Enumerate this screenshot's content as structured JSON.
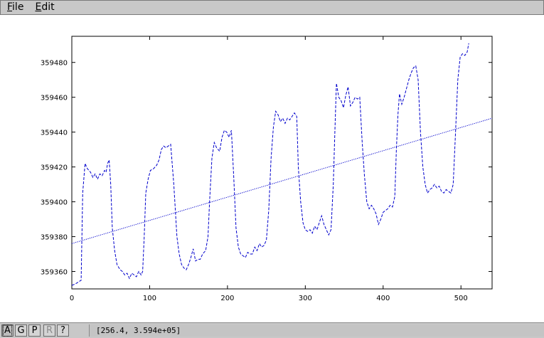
{
  "menubar": {
    "items": [
      {
        "label": "File",
        "mnemonic": "F",
        "rest": "ile"
      },
      {
        "label": "Edit",
        "mnemonic": "E",
        "rest": "dit"
      }
    ]
  },
  "toolbar": {
    "buttons": [
      {
        "label": "A",
        "state": "active"
      },
      {
        "label": "G",
        "state": "normal"
      },
      {
        "label": "P",
        "state": "normal"
      },
      {
        "label": "R",
        "state": "disabled"
      },
      {
        "label": "?",
        "state": "normal"
      }
    ]
  },
  "status": {
    "coords": "[256.4, 3.594e+05]"
  },
  "colors": {
    "series": "#0000cc",
    "background": "#ffffff",
    "chrome": "#c8c8c8"
  },
  "chart_data": {
    "type": "line",
    "title": "",
    "xlabel": "",
    "ylabel": "",
    "xlim": [
      0,
      540
    ],
    "ylim": [
      359350,
      359495
    ],
    "xticks": [
      0,
      100,
      200,
      300,
      400,
      500
    ],
    "yticks": [
      359360,
      359380,
      359400,
      359420,
      359440,
      359460,
      359480
    ],
    "grid": false,
    "legend": "none",
    "series": [
      {
        "style": "dashed",
        "points": [
          [
            0,
            359352
          ],
          [
            5,
            359353
          ],
          [
            12,
            359355
          ],
          [
            14,
            359405
          ],
          [
            17,
            359422
          ],
          [
            20,
            359419
          ],
          [
            24,
            359417
          ],
          [
            27,
            359414
          ],
          [
            30,
            359416
          ],
          [
            33,
            359413
          ],
          [
            36,
            359416
          ],
          [
            39,
            359415
          ],
          [
            42,
            359418
          ],
          [
            44,
            359417
          ],
          [
            46,
            359422
          ],
          [
            48,
            359424
          ],
          [
            50,
            359410
          ],
          [
            52,
            359385
          ],
          [
            55,
            359372
          ],
          [
            58,
            359364
          ],
          [
            62,
            359361
          ],
          [
            65,
            359360
          ],
          [
            68,
            359358
          ],
          [
            71,
            359359
          ],
          [
            74,
            359356
          ],
          [
            77,
            359359
          ],
          [
            80,
            359358
          ],
          [
            83,
            359357
          ],
          [
            86,
            359360
          ],
          [
            89,
            359358
          ],
          [
            91,
            359360
          ],
          [
            93,
            359380
          ],
          [
            95,
            359405
          ],
          [
            98,
            359413
          ],
          [
            101,
            359418
          ],
          [
            105,
            359419
          ],
          [
            109,
            359421
          ],
          [
            112,
            359424
          ],
          [
            115,
            359430
          ],
          [
            118,
            359432
          ],
          [
            121,
            359431
          ],
          [
            124,
            359432
          ],
          [
            127,
            359433
          ],
          [
            131,
            359410
          ],
          [
            135,
            359380
          ],
          [
            138,
            359370
          ],
          [
            141,
            359364
          ],
          [
            144,
            359362
          ],
          [
            147,
            359361
          ],
          [
            150,
            359364
          ],
          [
            153,
            359368
          ],
          [
            156,
            359373
          ],
          [
            159,
            359366
          ],
          [
            162,
            359367
          ],
          [
            165,
            359367
          ],
          [
            168,
            359370
          ],
          [
            172,
            359372
          ],
          [
            175,
            359380
          ],
          [
            177,
            359400
          ],
          [
            180,
            359425
          ],
          [
            183,
            359434
          ],
          [
            186,
            359431
          ],
          [
            190,
            359429
          ],
          [
            193,
            359437
          ],
          [
            196,
            359441
          ],
          [
            199,
            359440
          ],
          [
            202,
            359437
          ],
          [
            205,
            359441
          ],
          [
            208,
            359415
          ],
          [
            211,
            359385
          ],
          [
            214,
            359374
          ],
          [
            217,
            359370
          ],
          [
            220,
            359369
          ],
          [
            223,
            359368
          ],
          [
            226,
            359371
          ],
          [
            229,
            359370
          ],
          [
            232,
            359370
          ],
          [
            235,
            359374
          ],
          [
            238,
            359372
          ],
          [
            241,
            359376
          ],
          [
            244,
            359374
          ],
          [
            247,
            359375
          ],
          [
            250,
            359378
          ],
          [
            253,
            359395
          ],
          [
            256,
            359425
          ],
          [
            259,
            359443
          ],
          [
            262,
            359452
          ],
          [
            265,
            359450
          ],
          [
            268,
            359446
          ],
          [
            271,
            359448
          ],
          [
            274,
            359445
          ],
          [
            277,
            359448
          ],
          [
            280,
            359447
          ],
          [
            283,
            359449
          ],
          [
            286,
            359451
          ],
          [
            289,
            359449
          ],
          [
            291,
            359420
          ],
          [
            294,
            359400
          ],
          [
            297,
            359388
          ],
          [
            300,
            359384
          ],
          [
            303,
            359383
          ],
          [
            306,
            359384
          ],
          [
            309,
            359382
          ],
          [
            312,
            359386
          ],
          [
            315,
            359384
          ],
          [
            318,
            359388
          ],
          [
            321,
            359392
          ],
          [
            324,
            359387
          ],
          [
            327,
            359384
          ],
          [
            330,
            359381
          ],
          [
            333,
            359384
          ],
          [
            336,
            359410
          ],
          [
            338,
            359440
          ],
          [
            340,
            359468
          ],
          [
            343,
            359460
          ],
          [
            346,
            359458
          ],
          [
            349,
            359454
          ],
          [
            352,
            359461
          ],
          [
            355,
            359466
          ],
          [
            358,
            359455
          ],
          [
            361,
            359457
          ],
          [
            364,
            359460
          ],
          [
            367,
            359459
          ],
          [
            370,
            359460
          ],
          [
            373,
            359435
          ],
          [
            376,
            359415
          ],
          [
            379,
            359400
          ],
          [
            382,
            359396
          ],
          [
            385,
            359398
          ],
          [
            388,
            359396
          ],
          [
            391,
            359393
          ],
          [
            394,
            359387
          ],
          [
            397,
            359390
          ],
          [
            400,
            359394
          ],
          [
            403,
            359395
          ],
          [
            406,
            359396
          ],
          [
            409,
            359398
          ],
          [
            412,
            359397
          ],
          [
            415,
            359403
          ],
          [
            417,
            359430
          ],
          [
            419,
            359450
          ],
          [
            421,
            359462
          ],
          [
            424,
            359456
          ],
          [
            427,
            359460
          ],
          [
            430,
            359465
          ],
          [
            433,
            359470
          ],
          [
            436,
            359474
          ],
          [
            439,
            359477
          ],
          [
            442,
            359478
          ],
          [
            445,
            359470
          ],
          [
            448,
            359440
          ],
          [
            451,
            359420
          ],
          [
            454,
            359410
          ],
          [
            457,
            359405
          ],
          [
            460,
            359407
          ],
          [
            463,
            359408
          ],
          [
            466,
            359410
          ],
          [
            469,
            359408
          ],
          [
            472,
            359409
          ],
          [
            475,
            359406
          ],
          [
            478,
            359405
          ],
          [
            481,
            359407
          ],
          [
            484,
            359406
          ],
          [
            487,
            359405
          ],
          [
            490,
            359410
          ],
          [
            493,
            359440
          ],
          [
            496,
            359470
          ],
          [
            499,
            359483
          ],
          [
            502,
            359485
          ],
          [
            505,
            359484
          ],
          [
            508,
            359486
          ],
          [
            510,
            359491
          ]
        ]
      },
      {
        "style": "dotted",
        "name": "",
        "points": [
          [
            0,
            359376
          ],
          [
            540,
            359448
          ]
        ]
      }
    ]
  }
}
